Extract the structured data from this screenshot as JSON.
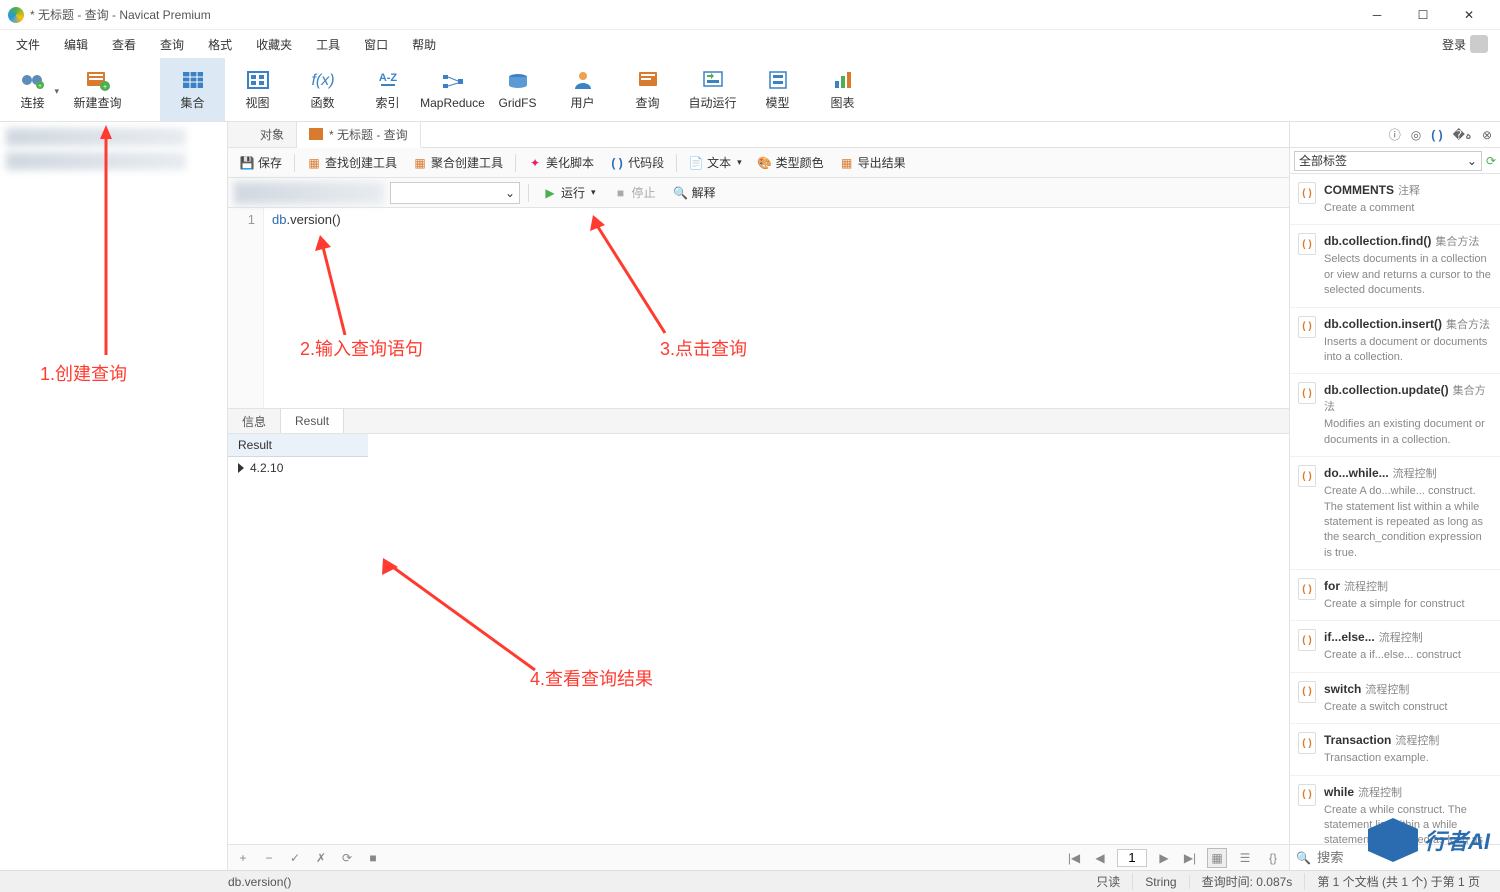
{
  "window": {
    "title": "* 无标题 - 查询 - Navicat Premium"
  },
  "menus": [
    "文件",
    "编辑",
    "查看",
    "查询",
    "格式",
    "收藏夹",
    "工具",
    "窗口",
    "帮助"
  ],
  "login": "登录",
  "toolbar": [
    {
      "label": "连接",
      "icon": "plug"
    },
    {
      "label": "新建查询",
      "icon": "newquery"
    },
    {
      "label": "集合",
      "icon": "table",
      "active": true
    },
    {
      "label": "视图",
      "icon": "view"
    },
    {
      "label": "函数",
      "icon": "fx"
    },
    {
      "label": "索引",
      "icon": "az"
    },
    {
      "label": "MapReduce",
      "icon": "mapreduce"
    },
    {
      "label": "GridFS",
      "icon": "gridfs"
    },
    {
      "label": "用户",
      "icon": "user"
    },
    {
      "label": "查询",
      "icon": "query"
    },
    {
      "label": "自动运行",
      "icon": "autorun"
    },
    {
      "label": "模型",
      "icon": "model"
    },
    {
      "label": "图表",
      "icon": "chart"
    }
  ],
  "tabs": [
    {
      "label": "对象",
      "active": false
    },
    {
      "label": "* 无标题 - 查询",
      "active": true
    }
  ],
  "queryToolbar": {
    "save": "保存",
    "qbuilder": "查找创建工具",
    "aggbuilder": "聚合创建工具",
    "beautify": "美化脚本",
    "snippet": "代码段",
    "text": "文本",
    "typecolor": "类型颜色",
    "export": "导出结果"
  },
  "runbar": {
    "run": "运行",
    "stop": "停止",
    "explain": "解释"
  },
  "editor": {
    "lineno": "1",
    "code_obj": "db",
    "code_dot": ".",
    "code_call": "version()"
  },
  "resultTabs": {
    "info": "信息",
    "result": "Result"
  },
  "resultGrid": {
    "header": "Result",
    "value": "4.2.10"
  },
  "pager": {
    "page": "1"
  },
  "rightPane": {
    "filter": "全部标签",
    "search_placeholder": "搜索",
    "snippets": [
      {
        "title": "COMMENTS",
        "tag": "注释",
        "desc": "Create a comment"
      },
      {
        "title": "db.collection.find()",
        "tag": "集合方法",
        "desc": "Selects documents in a collection or view and returns a cursor to the selected documents."
      },
      {
        "title": "db.collection.insert()",
        "tag": "集合方法",
        "desc": "Inserts a document or documents into a collection."
      },
      {
        "title": "db.collection.update()",
        "tag": "集合方法",
        "desc": "Modifies an existing document or documents in a collection."
      },
      {
        "title": "do...while...",
        "tag": "流程控制",
        "desc": "Create A do...while... construct. The statement list within a while statement is repeated as long as the search_condition expression is true."
      },
      {
        "title": "for",
        "tag": "流程控制",
        "desc": "Create a simple for construct"
      },
      {
        "title": "if...else...",
        "tag": "流程控制",
        "desc": "Create a if...else... construct"
      },
      {
        "title": "switch",
        "tag": "流程控制",
        "desc": "Create a switch construct"
      },
      {
        "title": "Transaction",
        "tag": "流程控制",
        "desc": "Transaction example."
      },
      {
        "title": "while",
        "tag": "流程控制",
        "desc": "Create a while construct. The statement list within a while statement is repeated as long as the search_condition expression is true."
      }
    ]
  },
  "status": {
    "code": "db.version()",
    "readonly": "只读",
    "type": "String",
    "time": "查询时间: 0.087s",
    "rec": "第 1 个文档 (共 1 个) 于第 1 页"
  },
  "annot": {
    "a1": "1.创建查询",
    "a2": "2.输入查询语句",
    "a3": "3.点击查询",
    "a4": "4.查看查询结果"
  },
  "watermark": "行者AI"
}
